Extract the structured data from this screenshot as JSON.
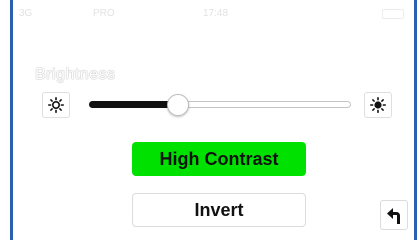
{
  "status_bar": {
    "carrier": "3G",
    "network": "PRO",
    "time": "17:48",
    "battery_icon": "battery-icon"
  },
  "brightness": {
    "label": "Brightness",
    "level": 0.34,
    "min_icon": "sun-low-icon",
    "max_icon": "sun-high-icon"
  },
  "buttons": {
    "high_contrast_label": "High Contrast",
    "invert_label": "Invert"
  },
  "back_icon": "back-arrow-icon",
  "colors": {
    "contrast_active": "#00e100",
    "frame_border": "#2b5fb0"
  }
}
